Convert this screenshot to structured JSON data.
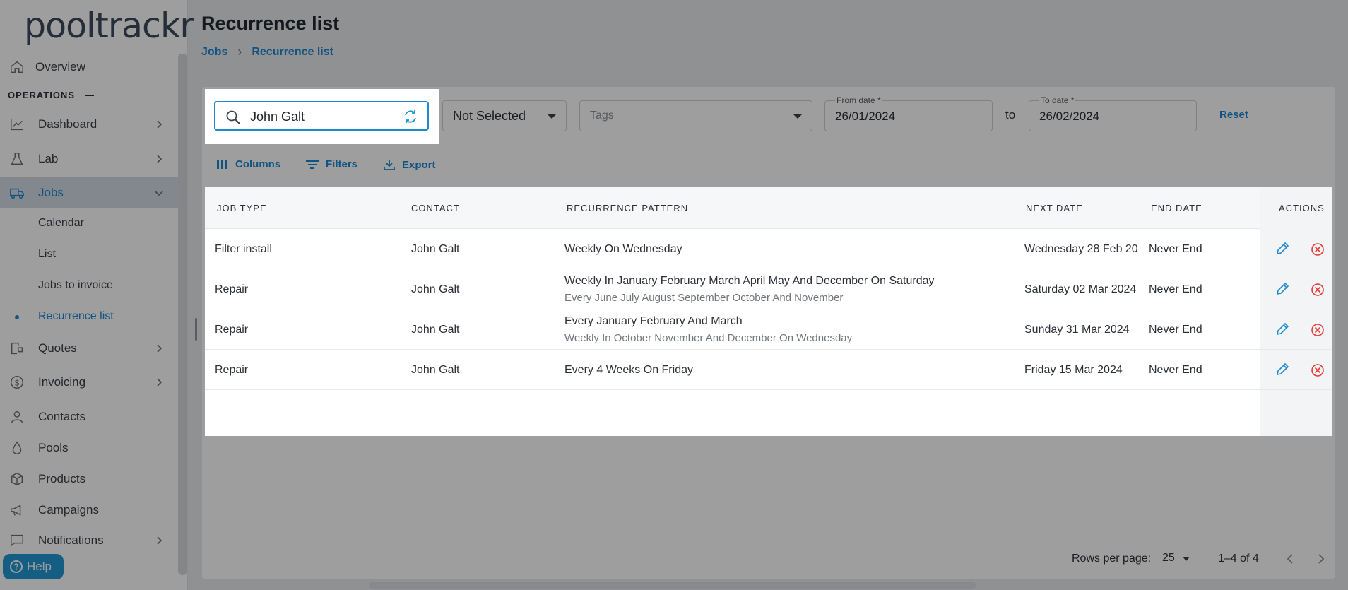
{
  "app": {
    "logo_text": "pooltrackr"
  },
  "sidebar": {
    "overview": "Overview",
    "section_title": "OPERATIONS",
    "section_toggle": "—",
    "items": [
      {
        "label": "Dashboard"
      },
      {
        "label": "Lab"
      },
      {
        "label": "Jobs"
      }
    ],
    "jobs_sub": [
      "Calendar",
      "List",
      "Jobs to invoice",
      "Recurrence list"
    ],
    "items2": [
      {
        "label": "Quotes"
      },
      {
        "label": "Invoicing"
      },
      {
        "label": "Contacts"
      },
      {
        "label": "Pools"
      },
      {
        "label": "Products"
      },
      {
        "label": "Campaigns"
      },
      {
        "label": "Notifications"
      }
    ],
    "help_label": "Help"
  },
  "header": {
    "title": "Recurrence list",
    "breadcrumb": [
      "Jobs",
      "Recurrence list"
    ]
  },
  "filters": {
    "search_value": "John Galt",
    "status_select": "Not Selected",
    "tags_placeholder": "Tags",
    "from_date_label": "From date *",
    "from_date": "26/01/2024",
    "to_label": "to",
    "to_date_label": "To date *",
    "to_date": "26/02/2024",
    "reset": "Reset"
  },
  "toolbar": {
    "columns": "Columns",
    "filters": "Filters",
    "export": "Export"
  },
  "table": {
    "headers": [
      "JOB TYPE",
      "CONTACT",
      "RECURRENCE PATTERN",
      "NEXT DATE",
      "END DATE",
      "ACTIONS"
    ],
    "rows": [
      {
        "job_type": "Filter install",
        "contact": "John Galt",
        "pattern": "Weekly On Wednesday",
        "pattern_sub": "",
        "next_date": "Wednesday 28 Feb 20",
        "end_date": "Never End"
      },
      {
        "job_type": "Repair",
        "contact": "John Galt",
        "pattern": "Weekly In January February March April May And December On Saturday",
        "pattern_sub": "Every June July August September October And November",
        "next_date": "Saturday 02 Mar 2024",
        "end_date": "Never End"
      },
      {
        "job_type": "Repair",
        "contact": "John Galt",
        "pattern": "Every January February And March",
        "pattern_sub": "Weekly In October November And December On Wednesday",
        "next_date": "Sunday 31 Mar 2024",
        "end_date": "Never End"
      },
      {
        "job_type": "Repair",
        "contact": "John Galt",
        "pattern": "Every 4 Weeks On Friday",
        "pattern_sub": "",
        "next_date": "Friday 15 Mar 2024",
        "end_date": "Never End"
      }
    ]
  },
  "pagination": {
    "rows_per_page_label": "Rows per page:",
    "rows_per_page": "25",
    "range": "1–4 of 4"
  },
  "colors": {
    "accent": "#1e88d0",
    "danger": "#e53935",
    "active_bg": "#d3dbe6"
  }
}
